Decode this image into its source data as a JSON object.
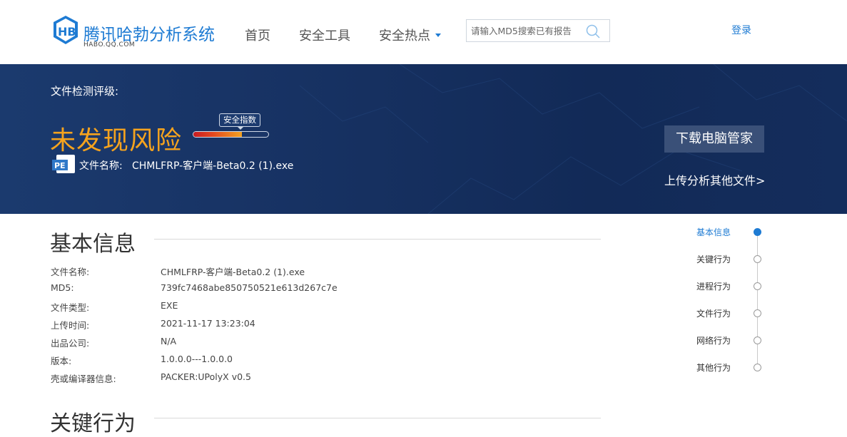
{
  "header": {
    "logo_title": "腾讯哈勃分析系统",
    "logo_sub": "HABO.QQ.COM",
    "nav": [
      {
        "label": "首页"
      },
      {
        "label": "安全工具"
      },
      {
        "label": "安全热点"
      }
    ],
    "search_placeholder": "请输入MD5搜索已有报告",
    "login": "登录"
  },
  "banner": {
    "rating_label": "文件检测评级:",
    "risk_text": "未发现风险",
    "safety_label": "安全指数",
    "safety_level": 0.65,
    "file_label": "文件名称:",
    "file_name": "CHMLFRP-客户端-Beta0.2 (1).exe",
    "download_button": "下载电脑管家",
    "upload_link": "上传分析其他文件>"
  },
  "basic_info": {
    "title": "基本信息",
    "rows": [
      {
        "key": "文件名称:",
        "value": "CHMLFRP-客户端-Beta0.2 (1).exe"
      },
      {
        "key": "MD5:",
        "value": "739fc7468abe850750521e613d267c7e"
      },
      {
        "key": "文件类型:",
        "value": "EXE"
      },
      {
        "key": "上传时间:",
        "value": "2021-11-17 13:23:04"
      },
      {
        "key": "出品公司:",
        "value": "N/A"
      },
      {
        "key": "版本:",
        "value": "1.0.0.0---1.0.0.0"
      },
      {
        "key": "壳或编译器信息:",
        "value": "PACKER:UPolyX v0.5"
      }
    ]
  },
  "key_behavior": {
    "title": "关键行为"
  },
  "timeline": [
    {
      "label": "基本信息",
      "active": true
    },
    {
      "label": "关键行为",
      "active": false
    },
    {
      "label": "进程行为",
      "active": false
    },
    {
      "label": "文件行为",
      "active": false
    },
    {
      "label": "网络行为",
      "active": false
    },
    {
      "label": "其他行为",
      "active": false
    }
  ],
  "colors": {
    "brand_blue": "#1e7bd3",
    "banner_bg": "#173263",
    "risk_orange": "#f5a31e",
    "download_btn_bg": "#3a5078"
  }
}
